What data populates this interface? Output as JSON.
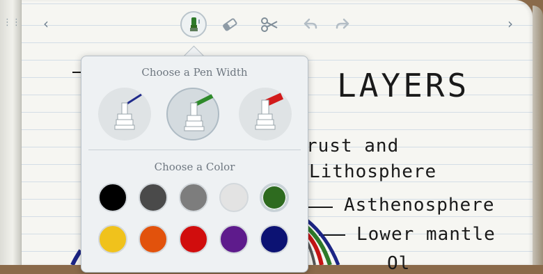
{
  "toolbar": {
    "prev_icon": "chevron-left-icon",
    "next_icon": "chevron-right-icon",
    "tools": [
      "pen-icon",
      "eraser-icon",
      "scissors-icon",
      "undo-icon",
      "redo-icon"
    ]
  },
  "notebook": {
    "title": "LAYERS",
    "lines": [
      "rust and",
      "Lithosphere",
      "Asthenosphere",
      "Lower mantle",
      "Ol"
    ]
  },
  "popover": {
    "pen_width_title": "Choose a Pen Width",
    "color_title": "Choose a Color",
    "pen_widths": [
      {
        "name": "thin",
        "tip_color": "#1f2a8a",
        "selected": false
      },
      {
        "name": "medium",
        "tip_color": "#2e8a2a",
        "selected": true
      },
      {
        "name": "thick",
        "tip_color": "#d21a1a",
        "selected": false
      }
    ],
    "colors": [
      {
        "hex": "#000000",
        "selected": false
      },
      {
        "hex": "#4a4a4a",
        "selected": false
      },
      {
        "hex": "#7d7d7d",
        "selected": false
      },
      {
        "hex": "#e3e3e3",
        "selected": false
      },
      {
        "hex": "#2e6b1f",
        "selected": true
      },
      {
        "hex": "#f0c21c",
        "selected": false
      },
      {
        "hex": "#e2520c",
        "selected": false
      },
      {
        "hex": "#d10d0d",
        "selected": false
      },
      {
        "hex": "#5e1b8c",
        "selected": false
      },
      {
        "hex": "#0c1273",
        "selected": false
      }
    ]
  }
}
